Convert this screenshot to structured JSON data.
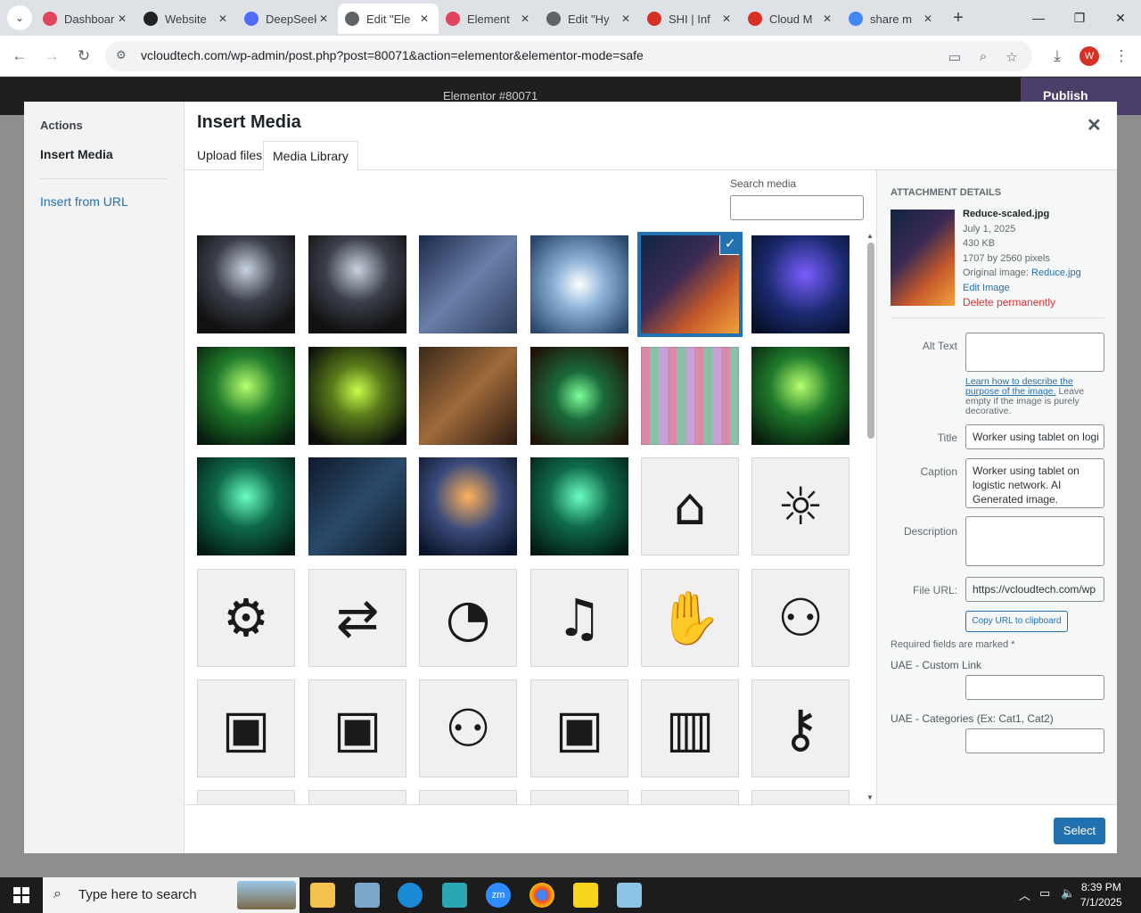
{
  "browser": {
    "tabs": [
      {
        "label": "Dashboard",
        "color": "#e2445c"
      },
      {
        "label": "Website",
        "color": "#222222"
      },
      {
        "label": "DeepSeek",
        "color": "#4d6bfe"
      },
      {
        "label": "Edit \"Ele",
        "color": "#5f6368",
        "active": true
      },
      {
        "label": "Element",
        "color": "#e2445c"
      },
      {
        "label": "Edit \"Hy",
        "color": "#5f6368"
      },
      {
        "label": "SHI | Inf",
        "color": "#d93025"
      },
      {
        "label": "Cloud M",
        "color": "#d93025"
      },
      {
        "label": "share m",
        "color": "#4285f4"
      }
    ],
    "url": "vcloudtech.com/wp-admin/post.php?post=80071&action=elementor&elementor-mode=safe",
    "profile_initial": "W"
  },
  "elementor": {
    "doc_title": "Elementor #80071",
    "publish_label": "Publish"
  },
  "modal": {
    "menu": {
      "heading": "Actions",
      "insert_media": "Insert Media",
      "insert_url": "Insert from URL"
    },
    "title": "Insert Media",
    "tabs": {
      "upload": "Upload files",
      "library": "Media Library"
    },
    "search_label": "Search media",
    "select_label": "Select",
    "attachment": {
      "heading": "Attachment Details",
      "filename": "Reduce-scaled.jpg",
      "date": "July 1, 2025",
      "size": "430 KB",
      "dimensions": "1707 by 2560 pixels",
      "original_label": "Original image:",
      "original_link": "Reduce.jpg",
      "edit_image": "Edit Image",
      "delete": "Delete permanently",
      "alt_label": "Alt Text",
      "alt_value": "",
      "hint_link": "Learn how to describe the purpose of the image.",
      "hint_text": "Leave empty if the image is purely decorative.",
      "title_label": "Title",
      "title_value": "Worker using tablet on logi",
      "caption_label": "Caption",
      "caption_value": "Worker using tablet on logistic network. AI Generated image.",
      "description_label": "Description",
      "description_value": "",
      "file_url_label": "File URL:",
      "file_url_value": "https://vcloudtech.com/wp",
      "copy_url": "Copy URL to clipboard",
      "required_note": "Required fields are marked *",
      "custom_link_label": "UAE - Custom Link",
      "categories_label": "UAE - Categories (Ex: Cat1, Cat2)"
    }
  },
  "taskbar": {
    "search_placeholder": "Type here to search",
    "time": "8:39 PM",
    "date": "7/1/2025"
  }
}
